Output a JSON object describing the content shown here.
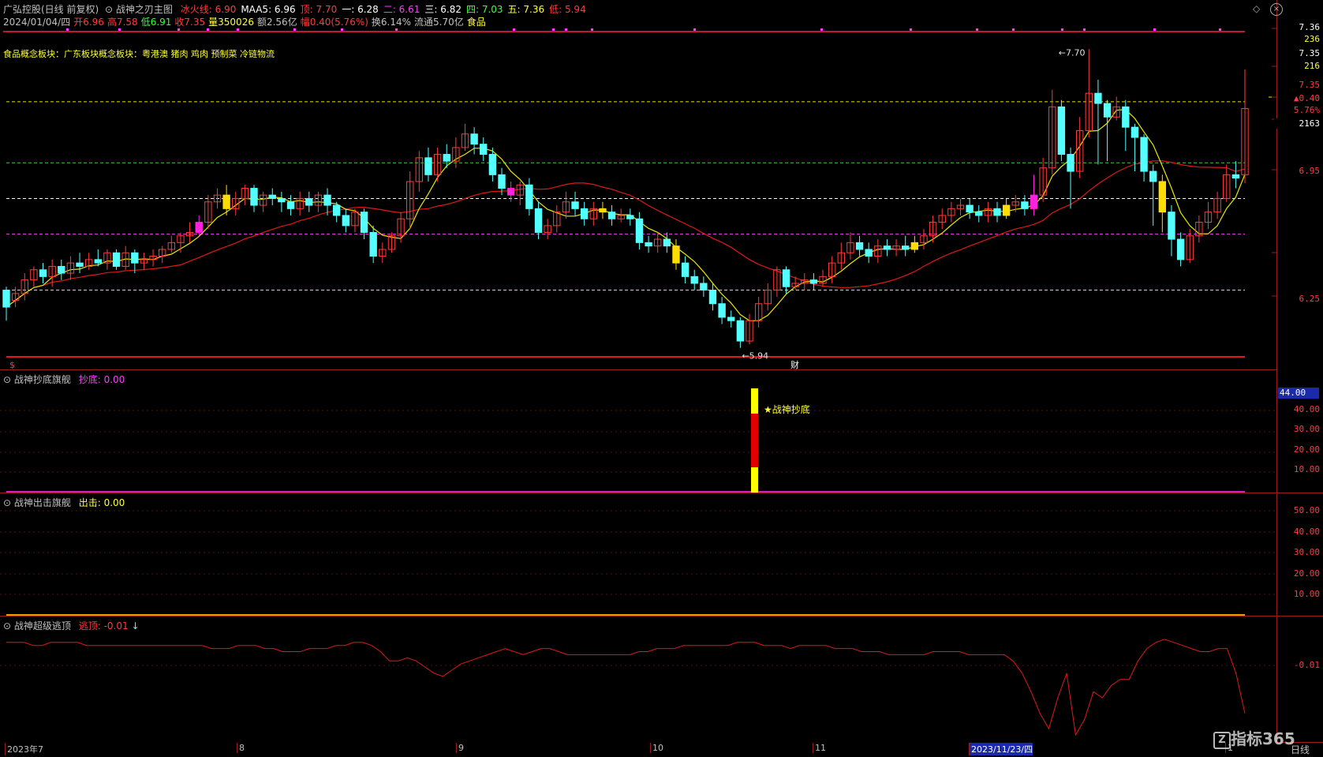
{
  "header": {
    "stock_name": "广弘控股(日线 前复权)",
    "indicator_name": "战神之刃主图",
    "items": [
      {
        "label": "冰火线: 6.90",
        "color": "#ff3b3b"
      },
      {
        "label": "MAA5: 6.96",
        "color": "#ffffff"
      },
      {
        "label": "顶: 7.70",
        "color": "#ff3b3b"
      },
      {
        "label": "一: 6.28",
        "color": "#ffffff"
      },
      {
        "label": "二: 6.61",
        "color": "#ff3bff"
      },
      {
        "label": "三: 6.82",
        "color": "#ffffff"
      },
      {
        "label": "四: 7.03",
        "color": "#3bff3b"
      },
      {
        "label": "五: 7.36",
        "color": "#ffff3b"
      },
      {
        "label": "低: 5.94",
        "color": "#ff3b3b"
      }
    ],
    "row2": [
      {
        "label": "2024/01/04/四",
        "color": "#c0c0c0"
      },
      {
        "label": "开6.96",
        "color": "#ff3b3b"
      },
      {
        "label": "高7.58",
        "color": "#ff3b3b"
      },
      {
        "label": "低6.91",
        "color": "#3bff3b"
      },
      {
        "label": "收7.35",
        "color": "#ff3b3b"
      },
      {
        "label": "量350026",
        "color": "#ffff3b"
      },
      {
        "label": "额2.56亿",
        "color": "#c0c0c0"
      },
      {
        "label": "幅0.40(5.76%)",
        "color": "#ff3b3b"
      },
      {
        "label": "换6.14%",
        "color": "#c0c0c0"
      },
      {
        "label": "流通5.70亿",
        "color": "#c0c0c0"
      },
      {
        "label": "食品",
        "color": "#ffff3b"
      }
    ],
    "concept": "食品概念板块：广东板块概念板块：粤港澳 猪肉 鸡肉 预制菜 冷链物流"
  },
  "main_axis": {
    "labels": [
      {
        "text": "7.36",
        "color": "#ffffff"
      },
      {
        "text": "236",
        "color": "#ffff3b"
      },
      {
        "text": "7.35",
        "color": "#ffffff"
      },
      {
        "text": "216",
        "color": "#ffff3b"
      },
      {
        "text": "7.35",
        "color": "#ff3b3b"
      },
      {
        "text": "▲0.40",
        "color": "#ff3b3b"
      },
      {
        "text": "5.76%",
        "color": "#ff3b3b"
      },
      {
        "text": "2163",
        "color": "#ffffff"
      },
      {
        "text": "6.95",
        "color": "#ff3b3b"
      },
      {
        "text": "6.25",
        "color": "#ff3b3b"
      }
    ],
    "high_label": "7.70",
    "low_label": "5.94",
    "cai_marker": "财",
    "dollar_marker": "$"
  },
  "panel2": {
    "title": "战神抄底旗舰",
    "value_label": "抄底: 0.00",
    "annotation": "★战神抄底",
    "axis": [
      "44.00",
      "40.00",
      "30.00",
      "20.00",
      "10.00"
    ]
  },
  "panel3": {
    "title": "战神出击旗舰",
    "value_label": "出击: 0.00",
    "axis": [
      "50.00",
      "40.00",
      "30.00",
      "20.00",
      "10.00"
    ]
  },
  "panel4": {
    "title": "战神超级逃顶",
    "value_label": "逃顶: -0.01",
    "arrow": "↓",
    "axis": [
      "-0.01"
    ]
  },
  "date_axis": {
    "labels": [
      "2023年7",
      "8",
      "9",
      "10",
      "11",
      "2023/11/23/四",
      "1"
    ],
    "period": "日线"
  },
  "watermark": "指标365",
  "colors": {
    "up": "#ff3b3b",
    "down": "#54ffff",
    "yellow_line": "#e8e800",
    "red_line": "#e01818",
    "magenta": "#ff00ff"
  },
  "candles": [
    [
      6.28,
      6.18,
      6.3,
      6.1
    ],
    [
      6.22,
      6.26,
      6.3,
      6.18
    ],
    [
      6.26,
      6.34,
      6.38,
      6.22
    ],
    [
      6.34,
      6.4,
      6.42,
      6.3
    ],
    [
      6.4,
      6.36,
      6.44,
      6.32
    ],
    [
      6.36,
      6.42,
      6.46,
      6.3
    ],
    [
      6.42,
      6.38,
      6.46,
      6.34
    ],
    [
      6.38,
      6.44,
      6.48,
      6.34
    ],
    [
      6.44,
      6.42,
      6.5,
      6.38
    ],
    [
      6.42,
      6.46,
      6.5,
      6.4
    ],
    [
      6.46,
      6.44,
      6.52,
      6.42
    ],
    [
      6.44,
      6.5,
      6.52,
      6.4
    ],
    [
      6.5,
      6.42,
      6.52,
      6.4
    ],
    [
      6.42,
      6.5,
      6.54,
      6.4
    ],
    [
      6.5,
      6.44,
      6.52,
      6.38
    ],
    [
      6.44,
      6.46,
      6.5,
      6.4
    ],
    [
      6.46,
      6.48,
      6.52,
      6.42
    ],
    [
      6.48,
      6.52,
      6.54,
      6.44
    ],
    [
      6.52,
      6.56,
      6.6,
      6.5
    ],
    [
      6.56,
      6.6,
      6.62,
      6.5
    ],
    [
      6.6,
      6.62,
      6.68,
      6.56
    ],
    [
      6.62,
      6.68,
      6.72,
      6.6
    ],
    [
      6.68,
      6.8,
      6.84,
      6.64
    ],
    [
      6.8,
      6.84,
      6.88,
      6.76
    ],
    [
      6.84,
      6.76,
      6.9,
      6.72
    ],
    [
      6.76,
      6.82,
      6.86,
      6.72
    ],
    [
      6.82,
      6.88,
      6.9,
      6.78
    ],
    [
      6.88,
      6.78,
      6.9,
      6.74
    ],
    [
      6.78,
      6.84,
      6.86,
      6.74
    ],
    [
      6.84,
      6.82,
      6.88,
      6.78
    ],
    [
      6.82,
      6.8,
      6.86,
      6.74
    ],
    [
      6.8,
      6.76,
      6.84,
      6.72
    ],
    [
      6.76,
      6.82,
      6.86,
      6.72
    ],
    [
      6.82,
      6.78,
      6.86,
      6.74
    ],
    [
      6.78,
      6.84,
      6.86,
      6.74
    ],
    [
      6.84,
      6.78,
      6.88,
      6.72
    ],
    [
      6.78,
      6.72,
      6.8,
      6.68
    ],
    [
      6.72,
      6.66,
      6.76,
      6.62
    ],
    [
      6.66,
      6.74,
      6.76,
      6.62
    ],
    [
      6.74,
      6.62,
      6.76,
      6.58
    ],
    [
      6.62,
      6.48,
      6.66,
      6.44
    ],
    [
      6.48,
      6.52,
      6.56,
      6.44
    ],
    [
      6.52,
      6.6,
      6.62,
      6.5
    ],
    [
      6.6,
      6.7,
      6.74,
      6.56
    ],
    [
      6.7,
      6.92,
      6.98,
      6.64
    ],
    [
      6.92,
      7.06,
      7.1,
      6.86
    ],
    [
      7.06,
      6.96,
      7.12,
      6.92
    ],
    [
      6.96,
      7.08,
      7.12,
      6.92
    ],
    [
      7.08,
      7.04,
      7.14,
      7.0
    ],
    [
      7.04,
      7.12,
      7.18,
      7.0
    ],
    [
      7.12,
      7.2,
      7.26,
      7.1
    ],
    [
      7.2,
      7.14,
      7.24,
      7.08
    ],
    [
      7.14,
      7.08,
      7.18,
      7.04
    ],
    [
      7.08,
      6.96,
      7.12,
      6.92
    ],
    [
      6.96,
      6.88,
      7.0,
      6.84
    ],
    [
      6.88,
      6.84,
      6.92,
      6.8
    ],
    [
      6.84,
      6.9,
      6.92,
      6.78
    ],
    [
      6.9,
      6.76,
      6.94,
      6.72
    ],
    [
      6.76,
      6.62,
      6.8,
      6.58
    ],
    [
      6.62,
      6.66,
      6.7,
      6.58
    ],
    [
      6.66,
      6.74,
      6.78,
      6.62
    ],
    [
      6.74,
      6.8,
      6.86,
      6.7
    ],
    [
      6.8,
      6.76,
      6.86,
      6.72
    ],
    [
      6.76,
      6.7,
      6.8,
      6.66
    ],
    [
      6.7,
      6.76,
      6.8,
      6.66
    ],
    [
      6.76,
      6.74,
      6.8,
      6.7
    ],
    [
      6.74,
      6.7,
      6.78,
      6.66
    ],
    [
      6.7,
      6.72,
      6.76,
      6.68
    ],
    [
      6.72,
      6.7,
      6.76,
      6.66
    ],
    [
      6.7,
      6.56,
      6.74,
      6.52
    ],
    [
      6.56,
      6.54,
      6.6,
      6.5
    ],
    [
      6.54,
      6.58,
      6.62,
      6.5
    ],
    [
      6.58,
      6.54,
      6.62,
      6.5
    ],
    [
      6.54,
      6.44,
      6.58,
      6.4
    ],
    [
      6.44,
      6.36,
      6.48,
      6.32
    ],
    [
      6.36,
      6.32,
      6.4,
      6.28
    ],
    [
      6.32,
      6.28,
      6.36,
      6.24
    ],
    [
      6.28,
      6.2,
      6.32,
      6.16
    ],
    [
      6.2,
      6.12,
      6.24,
      6.08
    ],
    [
      6.12,
      6.1,
      6.16,
      6.06
    ],
    [
      6.1,
      5.98,
      6.12,
      5.94
    ],
    [
      5.98,
      6.1,
      6.14,
      5.96
    ],
    [
      6.1,
      6.2,
      6.24,
      6.06
    ],
    [
      6.2,
      6.28,
      6.32,
      6.16
    ],
    [
      6.28,
      6.4,
      6.42,
      6.24
    ],
    [
      6.4,
      6.3,
      6.42,
      6.26
    ],
    [
      6.3,
      6.32,
      6.36,
      6.28
    ],
    [
      6.32,
      6.34,
      6.38,
      6.28
    ],
    [
      6.34,
      6.32,
      6.38,
      6.28
    ],
    [
      6.32,
      6.36,
      6.4,
      6.3
    ],
    [
      6.36,
      6.44,
      6.48,
      6.32
    ],
    [
      6.44,
      6.5,
      6.56,
      6.4
    ],
    [
      6.5,
      6.56,
      6.62,
      6.46
    ],
    [
      6.56,
      6.52,
      6.6,
      6.48
    ],
    [
      6.52,
      6.48,
      6.56,
      6.44
    ],
    [
      6.48,
      6.54,
      6.58,
      6.44
    ],
    [
      6.54,
      6.52,
      6.58,
      6.48
    ],
    [
      6.52,
      6.54,
      6.58,
      6.48
    ],
    [
      6.54,
      6.52,
      6.6,
      6.48
    ],
    [
      6.52,
      6.56,
      6.6,
      6.5
    ],
    [
      6.56,
      6.6,
      6.64,
      6.52
    ],
    [
      6.6,
      6.68,
      6.72,
      6.56
    ],
    [
      6.68,
      6.72,
      6.76,
      6.64
    ],
    [
      6.72,
      6.76,
      6.8,
      6.68
    ],
    [
      6.76,
      6.78,
      6.82,
      6.72
    ],
    [
      6.78,
      6.74,
      6.82,
      6.7
    ],
    [
      6.74,
      6.72,
      6.78,
      6.68
    ],
    [
      6.72,
      6.76,
      6.8,
      6.68
    ],
    [
      6.76,
      6.72,
      6.8,
      6.68
    ],
    [
      6.72,
      6.78,
      6.82,
      6.7
    ],
    [
      6.78,
      6.8,
      6.84,
      6.74
    ],
    [
      6.8,
      6.76,
      6.84,
      6.72
    ],
    [
      6.76,
      6.84,
      6.96,
      6.72
    ],
    [
      6.84,
      7.0,
      7.06,
      6.8
    ],
    [
      7.0,
      7.36,
      7.46,
      6.96
    ],
    [
      7.36,
      7.08,
      7.4,
      7.04
    ],
    [
      7.08,
      6.98,
      7.12,
      6.76
    ],
    [
      6.98,
      7.22,
      7.3,
      6.94
    ],
    [
      7.22,
      7.44,
      7.7,
      7.18
    ],
    [
      7.44,
      7.38,
      7.52,
      7.02
    ],
    [
      7.38,
      7.3,
      7.4,
      7.04
    ],
    [
      7.3,
      7.36,
      7.42,
      7.28
    ],
    [
      7.36,
      7.24,
      7.4,
      7.1
    ],
    [
      7.24,
      7.18,
      7.26,
      6.98
    ],
    [
      7.18,
      6.98,
      7.2,
      6.92
    ],
    [
      6.98,
      6.92,
      7.02,
      6.66
    ],
    [
      6.92,
      6.74,
      6.96,
      6.62
    ],
    [
      6.74,
      6.58,
      6.78,
      6.48
    ],
    [
      6.58,
      6.46,
      6.62,
      6.42
    ],
    [
      6.46,
      6.6,
      6.64,
      6.44
    ],
    [
      6.6,
      6.68,
      6.72,
      6.56
    ],
    [
      6.68,
      6.74,
      6.8,
      6.64
    ],
    [
      6.74,
      6.82,
      6.86,
      6.7
    ],
    [
      6.82,
      6.96,
      7.02,
      6.8
    ],
    [
      6.96,
      6.94,
      7.04,
      6.88
    ],
    [
      6.96,
      7.35,
      7.58,
      6.91
    ]
  ],
  "special_bars": {
    "magenta": [
      21,
      55,
      112
    ],
    "yellow": [
      24,
      65,
      73,
      99,
      109,
      126
    ]
  },
  "panel4_series": [
    -0.002,
    -0.002,
    -0.002,
    -0.003,
    -0.003,
    -0.002,
    -0.002,
    -0.002,
    -0.002,
    -0.003,
    -0.003,
    -0.003,
    -0.003,
    -0.003,
    -0.003,
    -0.003,
    -0.003,
    -0.003,
    -0.003,
    -0.003,
    -0.003,
    -0.003,
    -0.003,
    -0.004,
    -0.004,
    -0.004,
    -0.003,
    -0.003,
    -0.003,
    -0.004,
    -0.004,
    -0.005,
    -0.005,
    -0.005,
    -0.004,
    -0.004,
    -0.004,
    -0.003,
    -0.003,
    -0.002,
    -0.002,
    -0.003,
    -0.005,
    -0.008,
    -0.008,
    -0.007,
    -0.008,
    -0.01,
    -0.012,
    -0.013,
    -0.011,
    -0.009,
    -0.008,
    -0.007,
    -0.006,
    -0.005,
    -0.004,
    -0.005,
    -0.006,
    -0.005,
    -0.004,
    -0.004,
    -0.005,
    -0.006,
    -0.006,
    -0.006,
    -0.006,
    -0.006,
    -0.006,
    -0.006,
    -0.006,
    -0.005,
    -0.005,
    -0.004,
    -0.004,
    -0.004,
    -0.003,
    -0.003,
    -0.003,
    -0.003,
    -0.003,
    -0.003,
    -0.002,
    -0.002,
    -0.002,
    -0.003,
    -0.003,
    -0.003,
    -0.004,
    -0.003,
    -0.003,
    -0.003,
    -0.003,
    -0.004,
    -0.004,
    -0.004,
    -0.005,
    -0.005,
    -0.005,
    -0.006,
    -0.006,
    -0.006,
    -0.006,
    -0.006,
    -0.005,
    -0.005,
    -0.005,
    -0.005,
    -0.006,
    -0.006,
    -0.006,
    -0.006,
    -0.006,
    -0.008,
    -0.012,
    -0.018,
    -0.025,
    -0.03,
    -0.02,
    -0.012,
    -0.032,
    -0.027,
    -0.018,
    -0.02,
    -0.016,
    -0.014,
    -0.014,
    -0.008,
    -0.004,
    -0.002,
    -0.001,
    -0.002,
    -0.003,
    -0.004,
    -0.005,
    -0.005,
    -0.004,
    -0.004,
    -0.012,
    -0.025
  ]
}
